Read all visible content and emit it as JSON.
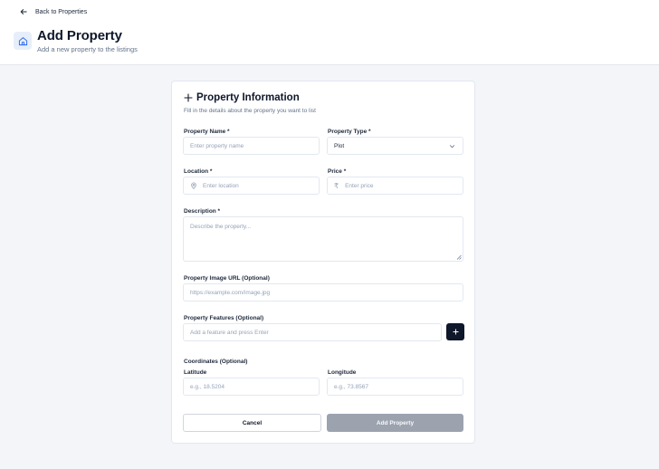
{
  "header": {
    "back_label": "Back to Properties",
    "title": "Add Property",
    "subtitle": "Add a new property to the listings"
  },
  "form": {
    "title": "Property Information",
    "subtitle": "Fill in the details about the property you want to list",
    "property_name": {
      "label": "Property Name *",
      "placeholder": "Enter property name"
    },
    "property_type": {
      "label": "Property Type *",
      "value": "Plot"
    },
    "location": {
      "label": "Location *",
      "placeholder": "Enter location"
    },
    "price": {
      "label": "Price *",
      "currency_symbol": "₹",
      "placeholder": "Enter price"
    },
    "description": {
      "label": "Description *",
      "placeholder": "Describe the property..."
    },
    "image_url": {
      "label": "Property Image URL (Optional)",
      "placeholder": "https://example.com/image.jpg"
    },
    "features": {
      "label": "Property Features (Optional)",
      "placeholder": "Add a feature and press Enter"
    },
    "coordinates": {
      "label": "Coordinates (Optional)",
      "latitude": {
        "label": "Latitude",
        "placeholder": "e.g., 18.5204"
      },
      "longitude": {
        "label": "Longitude",
        "placeholder": "e.g., 73.8567"
      }
    },
    "buttons": {
      "cancel": "Cancel",
      "submit": "Add Property"
    }
  },
  "colors": {
    "primary": "#0f172a",
    "submit_disabled": "#9ca3af",
    "page_background": "#f3f5f8",
    "icon_tile": "#e6eef9"
  },
  "icons": {
    "back": "arrow-left-icon",
    "page": "home-icon",
    "card_title": "plus-icon",
    "location": "map-pin-icon",
    "select": "chevron-down-icon",
    "add_feature": "plus-icon"
  }
}
